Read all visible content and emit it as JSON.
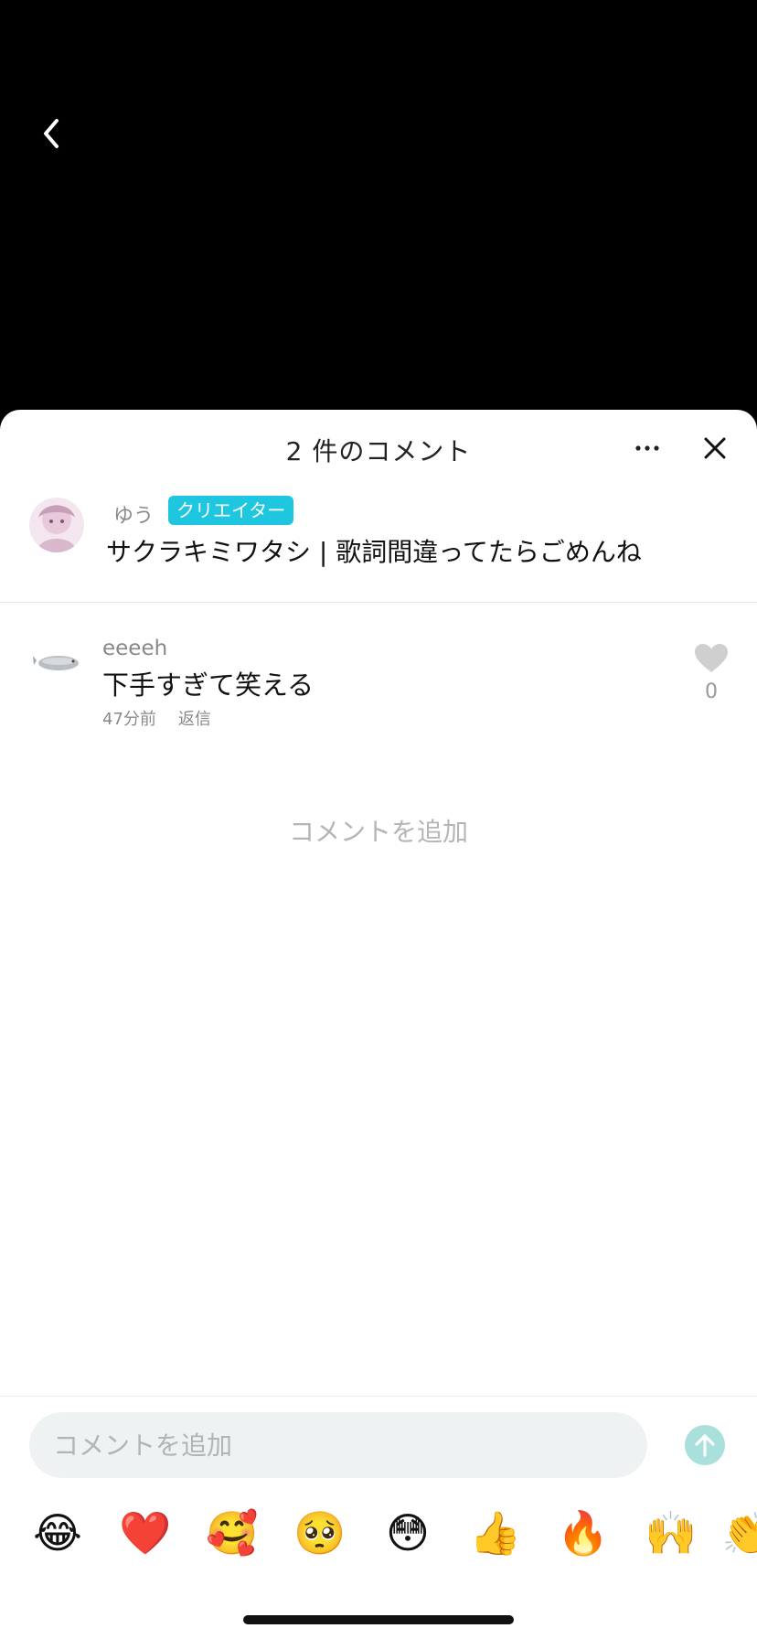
{
  "sheet": {
    "title": "2 件のコメント"
  },
  "creator_post": {
    "username": "ゆう",
    "badge": "クリエイター",
    "caption": "サクラキミワタシ | 歌詞間違ってたらごめんね"
  },
  "comments": [
    {
      "username": "eeeeh",
      "text": "下手すぎて笑える",
      "time": "47分前",
      "reply_label": "返信",
      "like_count": "0"
    }
  ],
  "add_comment_prompt": "コメントを追加",
  "composer": {
    "placeholder": "コメントを追加"
  },
  "emojis": [
    "😂",
    "❤️",
    "🥰",
    "🥺",
    "😳",
    "👍",
    "🔥",
    "🙌",
    "👏"
  ],
  "colors": {
    "badge": "#1fc6e0",
    "send_button": "#a9e0dc",
    "input_background": "#eff2f2"
  }
}
